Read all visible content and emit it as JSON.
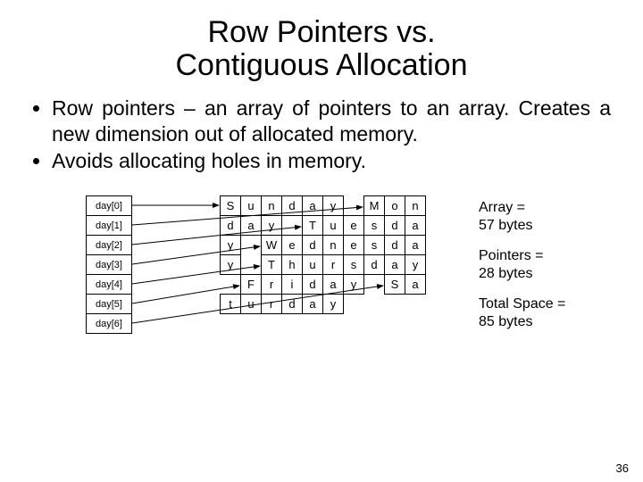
{
  "title_line1": "Row Pointers vs.",
  "title_line2": "Contiguous Allocation",
  "bullet1": "Row pointers – an array of pointers to an array. Creates a new dimension out of allocated memory.",
  "bullet2": "Avoids allocating holes in memory.",
  "ptr_labels": [
    "day[0]",
    "day[1]",
    "day[2]",
    "day[3]",
    "day[4]",
    "day[5]",
    "day[6]"
  ],
  "char_rows": [
    [
      "S",
      "u",
      "n",
      "d",
      "a",
      "y",
      "",
      "M",
      "o",
      "n"
    ],
    [
      "d",
      "a",
      "y",
      "",
      "T",
      "u",
      "e",
      "s",
      "d",
      "a"
    ],
    [
      "y",
      "",
      "W",
      "e",
      "d",
      "n",
      "e",
      "s",
      "d",
      "a"
    ],
    [
      "y",
      "",
      "T",
      "h",
      "u",
      "r",
      "s",
      "d",
      "a",
      "y"
    ],
    [
      "",
      "F",
      "r",
      "i",
      "d",
      "a",
      "y",
      "",
      "S",
      "a"
    ],
    [
      "t",
      "u",
      "r",
      "d",
      "a",
      "y",
      "",
      "",
      "",
      ""
    ]
  ],
  "gaps": {
    "0": [
      6
    ],
    "1": [
      3
    ],
    "2": [
      1
    ],
    "3": [
      1
    ],
    "4": [
      0,
      7
    ],
    "5": [
      6,
      7,
      8,
      9
    ]
  },
  "info_array_l1": "Array =",
  "info_array_l2": "57 bytes",
  "info_ptr_l1": "Pointers =",
  "info_ptr_l2": "28 bytes",
  "info_total_l1": "Total Space =",
  "info_total_l2": "85 bytes",
  "page_number": "36"
}
